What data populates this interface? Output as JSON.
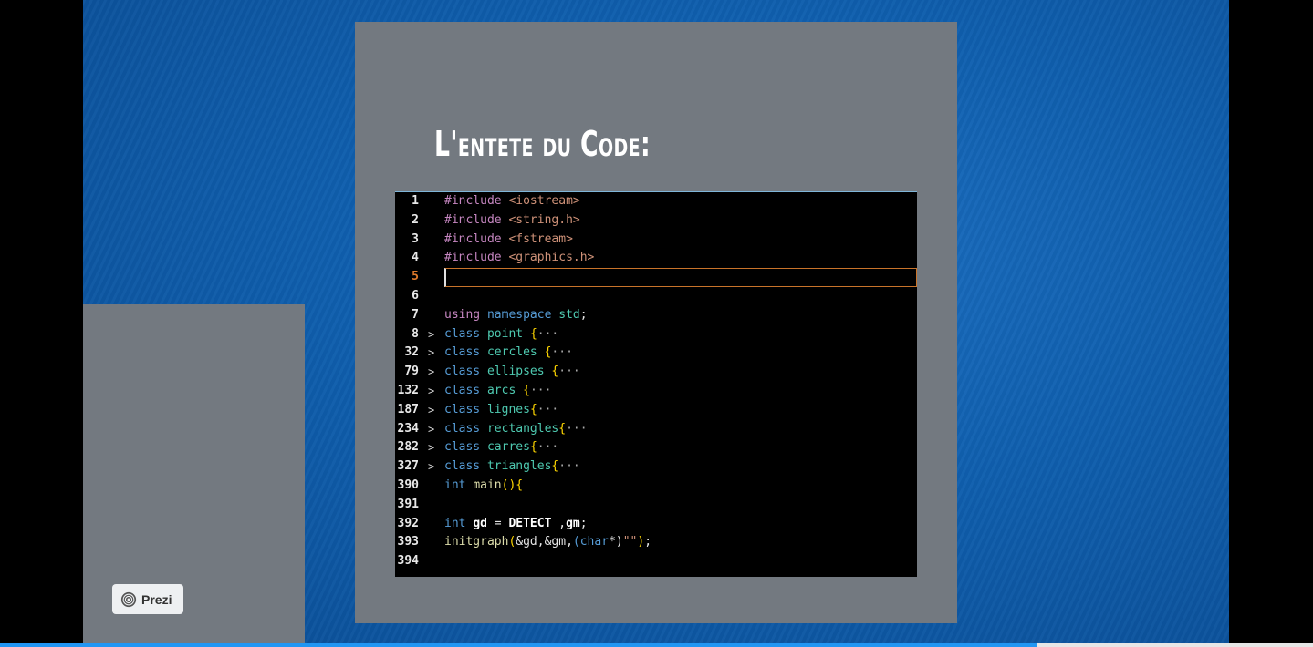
{
  "slide": {
    "title": "L'entete du Code:"
  },
  "code_lines": [
    {
      "n": "1",
      "fold": "",
      "tokens": [
        {
          "c": "kw-pre",
          "t": "#include "
        },
        {
          "c": "str",
          "t": "<iostream>"
        }
      ]
    },
    {
      "n": "2",
      "fold": "",
      "tokens": [
        {
          "c": "kw-pre",
          "t": "#include "
        },
        {
          "c": "str",
          "t": "<string.h>"
        }
      ]
    },
    {
      "n": "3",
      "fold": "",
      "tokens": [
        {
          "c": "kw-pre",
          "t": "#include "
        },
        {
          "c": "str",
          "t": "<fstream>"
        }
      ]
    },
    {
      "n": "4",
      "fold": "",
      "tokens": [
        {
          "c": "kw-pre",
          "t": "#include "
        },
        {
          "c": "str",
          "t": "<graphics.h>"
        }
      ]
    },
    {
      "n": "5",
      "fold": "",
      "active": true,
      "tokens": []
    },
    {
      "n": "6",
      "fold": "",
      "tokens": []
    },
    {
      "n": "7",
      "fold": "",
      "tokens": [
        {
          "c": "kw-pre",
          "t": "using "
        },
        {
          "c": "kw",
          "t": "namespace "
        },
        {
          "c": "type",
          "t": "std"
        },
        {
          "c": "plain",
          "t": ";"
        }
      ]
    },
    {
      "n": "8",
      "fold": ">",
      "tokens": [
        {
          "c": "kw",
          "t": "class "
        },
        {
          "c": "type",
          "t": "point "
        },
        {
          "c": "brace",
          "t": "{"
        },
        {
          "c": "ellip",
          "t": "···"
        }
      ]
    },
    {
      "n": "32",
      "fold": ">",
      "tokens": [
        {
          "c": "kw",
          "t": "class "
        },
        {
          "c": "type",
          "t": "cercles "
        },
        {
          "c": "brace",
          "t": "{"
        },
        {
          "c": "ellip",
          "t": "···"
        }
      ]
    },
    {
      "n": "79",
      "fold": ">",
      "tokens": [
        {
          "c": "kw",
          "t": "class "
        },
        {
          "c": "type",
          "t": "ellipses "
        },
        {
          "c": "brace",
          "t": "{"
        },
        {
          "c": "ellip",
          "t": "···"
        }
      ]
    },
    {
      "n": "132",
      "fold": ">",
      "tokens": [
        {
          "c": "kw",
          "t": "class "
        },
        {
          "c": "type",
          "t": "arcs "
        },
        {
          "c": "brace",
          "t": "{"
        },
        {
          "c": "ellip",
          "t": "···"
        }
      ]
    },
    {
      "n": "187",
      "fold": ">",
      "tokens": [
        {
          "c": "kw",
          "t": "class "
        },
        {
          "c": "type",
          "t": "lignes"
        },
        {
          "c": "brace",
          "t": "{"
        },
        {
          "c": "ellip",
          "t": "···"
        }
      ]
    },
    {
      "n": "234",
      "fold": ">",
      "tokens": [
        {
          "c": "kw",
          "t": "class "
        },
        {
          "c": "type",
          "t": "rectangles"
        },
        {
          "c": "brace",
          "t": "{"
        },
        {
          "c": "ellip",
          "t": "···"
        }
      ]
    },
    {
      "n": "282",
      "fold": ">",
      "tokens": [
        {
          "c": "kw",
          "t": "class "
        },
        {
          "c": "type",
          "t": "carres"
        },
        {
          "c": "brace",
          "t": "{"
        },
        {
          "c": "ellip",
          "t": "···"
        }
      ]
    },
    {
      "n": "327",
      "fold": ">",
      "tokens": [
        {
          "c": "kw",
          "t": "class "
        },
        {
          "c": "type",
          "t": "triangles"
        },
        {
          "c": "brace",
          "t": "{"
        },
        {
          "c": "ellip",
          "t": "···"
        }
      ]
    },
    {
      "n": "390",
      "fold": "",
      "tokens": [
        {
          "c": "kw",
          "t": "int "
        },
        {
          "c": "fn",
          "t": "main"
        },
        {
          "c": "brace",
          "t": "(){"
        }
      ]
    },
    {
      "n": "391",
      "fold": "",
      "tokens": []
    },
    {
      "n": "392",
      "fold": "",
      "tokens": [
        {
          "c": "kw",
          "t": "int "
        },
        {
          "c": "var",
          "t": "gd"
        },
        {
          "c": "plain",
          "t": " = "
        },
        {
          "c": "var",
          "t": "DETECT"
        },
        {
          "c": "plain",
          "t": " ,"
        },
        {
          "c": "var",
          "t": "gm"
        },
        {
          "c": "plain",
          "t": ";"
        }
      ]
    },
    {
      "n": "393",
      "fold": "",
      "tokens": [
        {
          "c": "fn",
          "t": "initgraph"
        },
        {
          "c": "brace",
          "t": "("
        },
        {
          "c": "plain",
          "t": "&gd,&gm,"
        },
        {
          "c": "kw",
          "t": "(char"
        },
        {
          "c": "plain",
          "t": "*)"
        },
        {
          "c": "str",
          "t": "\"\""
        },
        {
          "c": "brace",
          "t": ")"
        },
        {
          "c": "plain",
          "t": ";"
        }
      ]
    },
    {
      "n": "394",
      "fold": "",
      "tokens": []
    }
  ],
  "badge": {
    "label": "Prezi",
    "icon": "prezi-logo-icon"
  },
  "colors": {
    "background": "#0f5fae",
    "panel": "#737980",
    "code_bg": "#000000",
    "progress": "#2196f3"
  }
}
